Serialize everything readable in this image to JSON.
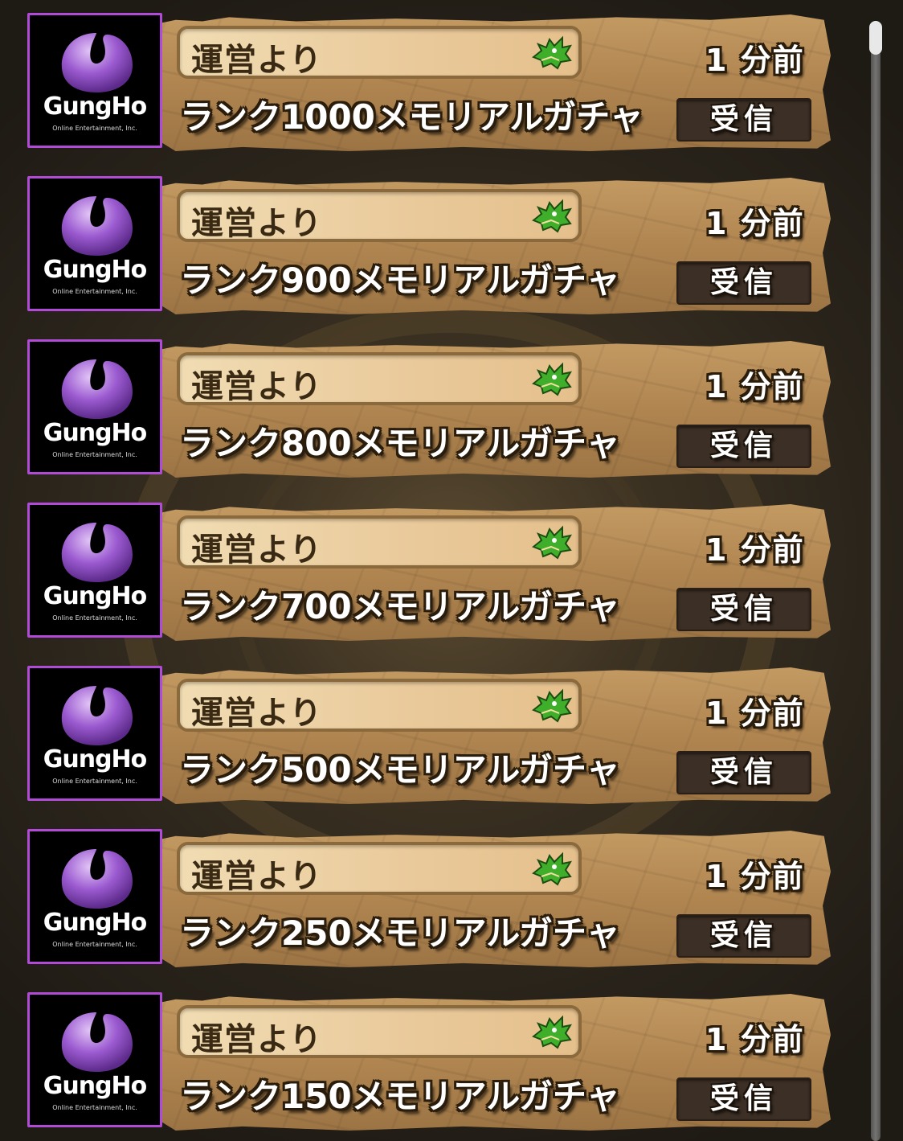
{
  "mail": [
    {
      "sender": "運営より",
      "subject": "ランク1000メモリアルガチャ",
      "time": "1 分前",
      "button": "受信"
    },
    {
      "sender": "運営より",
      "subject": "ランク900メモリアルガチャ",
      "time": "1 分前",
      "button": "受信"
    },
    {
      "sender": "運営より",
      "subject": "ランク800メモリアルガチャ",
      "time": "1 分前",
      "button": "受信"
    },
    {
      "sender": "運営より",
      "subject": "ランク700メモリアルガチャ",
      "time": "1 分前",
      "button": "受信"
    },
    {
      "sender": "運営より",
      "subject": "ランク500メモリアルガチャ",
      "time": "1 分前",
      "button": "受信"
    },
    {
      "sender": "運営より",
      "subject": "ランク250メモリアルガチャ",
      "time": "1 分前",
      "button": "受信"
    },
    {
      "sender": "運営より",
      "subject": "ランク150メモリアルガチャ",
      "time": "1 分前",
      "button": "受信"
    }
  ],
  "logo": {
    "name": "GungHo",
    "tagline": "Online Entertainment, Inc."
  },
  "colors": {
    "avatar_border": "#b14ad6",
    "panel": "#b08550",
    "button": "#3c2f25",
    "logo_purple": "#9b5ad0"
  },
  "icons": {
    "sender": "dragon-icon",
    "avatar": "gungho-logo"
  }
}
